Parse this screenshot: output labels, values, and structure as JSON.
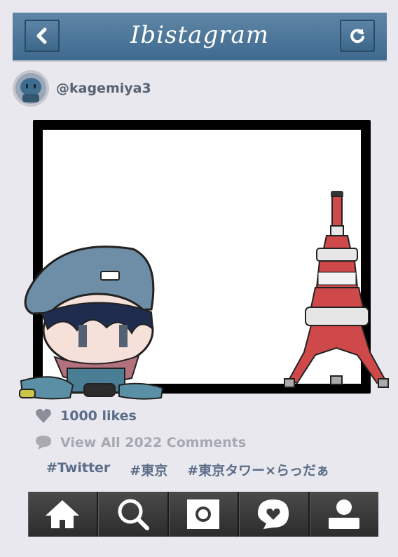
{
  "header": {
    "title": "Ibistagram",
    "back_icon": "chevron-left-icon",
    "refresh_icon": "refresh-icon"
  },
  "post": {
    "username": "@kagemiya3",
    "likes": "1000 likes",
    "comments_link": "View All 2022 Comments",
    "hashtags": [
      "#Twitter",
      "#東京",
      "#東京タワー×らっだぁ"
    ]
  },
  "tabbar": {
    "items": [
      "home-icon",
      "search-icon",
      "camera-icon",
      "activity-icon",
      "profile-icon"
    ]
  },
  "colors": {
    "header": "#4e7699",
    "frame": "#000000",
    "tower_red": "#d0494a",
    "text_blue": "#5b6d88"
  }
}
